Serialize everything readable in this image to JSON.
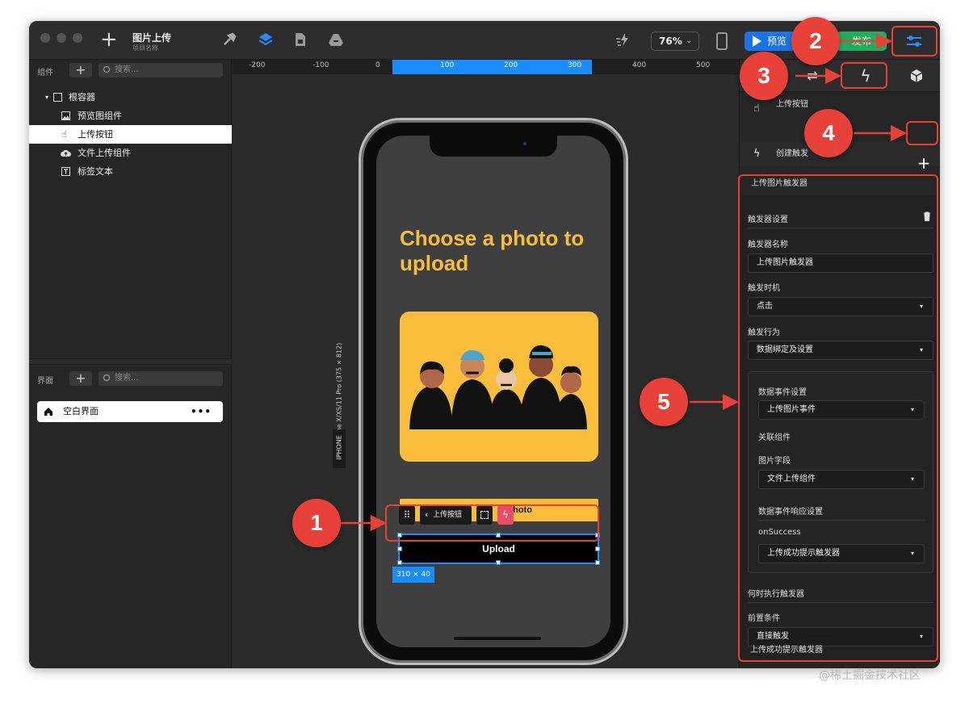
{
  "app": {
    "title": "图片上传",
    "subtitle": "项目名称",
    "zoom": "76%",
    "preview_label": "预览",
    "publish_label": "发布"
  },
  "components_panel": {
    "label": "组件",
    "search_placeholder": "搜索...",
    "tree": [
      {
        "label": "根容器",
        "icon": "square-icon"
      },
      {
        "label": "预览图组件",
        "icon": "image-icon"
      },
      {
        "label": "上传按钮",
        "icon": "hand-pointer-icon"
      },
      {
        "label": "文件上传组件",
        "icon": "cloud-upload-icon"
      },
      {
        "label": "标签文本",
        "icon": "text-icon"
      }
    ]
  },
  "pages_panel": {
    "label": "界面",
    "search_placeholder": "搜索...",
    "pages": [
      {
        "label": "空白界面",
        "more": "•••"
      }
    ]
  },
  "ruler": {
    "ticks": [
      "-200",
      "-100",
      "0",
      "100",
      "200",
      "300",
      "400",
      "500"
    ]
  },
  "device": {
    "label": "iPhone X/XS/11 Pro (375 × 812)",
    "tag": "IPHONE"
  },
  "screen": {
    "headline": "Choose a photo to upload",
    "photo_button": "photo",
    "upload_button": "Upload",
    "selection_label": "上传按钮",
    "size_tag": "310 × 40"
  },
  "right_panel": {
    "selected_component": "上传按钮",
    "create_trigger": "创建触发",
    "trigger_title": "上传图片触发器",
    "trigger_settings": "触发器设置",
    "name_label": "触发器名称",
    "name_value": "上传图片触发器",
    "timing_label": "触发时机",
    "timing_value": "点击",
    "action_label": "触发行为",
    "action_value": "数据绑定及设置",
    "event_settings": "数据事件设置",
    "event_value": "上传图片事件",
    "related_label": "关联组件",
    "image_field_label": "图片字段",
    "image_field_value": "文件上传组件",
    "response_settings": "数据事件响应设置",
    "on_success_label": "onSuccess",
    "on_success_value": "上传成功提示触发器",
    "when_label": "何时执行触发器",
    "precondition_label": "前置条件",
    "precondition_value": "直接触发",
    "next_trigger": "上传成功提示触发器"
  },
  "annotations": [
    "1",
    "2",
    "3",
    "4",
    "5"
  ],
  "watermark": "@稀土掘金技术社区",
  "colors": {
    "accent": "#1a8cff",
    "brand_yellow": "#fbbd3c",
    "annotation_red": "#e8413a",
    "publish_green": "#1fae5d"
  }
}
